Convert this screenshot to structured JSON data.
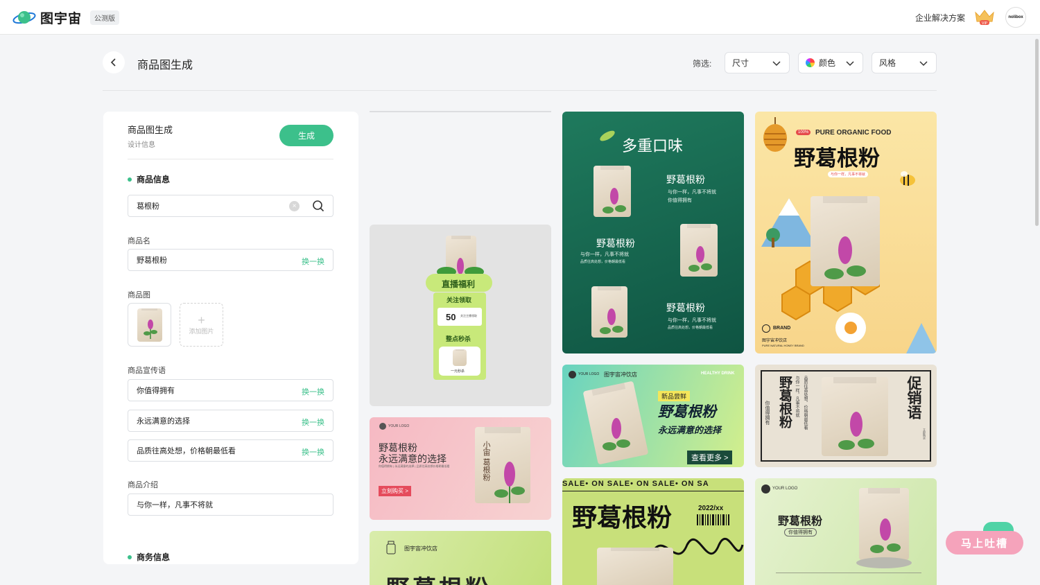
{
  "brand": {
    "name": "图宇宙",
    "beta": "公测版"
  },
  "topbar": {
    "enterprise": "企业解决方案",
    "vip": "VIP",
    "avatar": "nolibox"
  },
  "header": {
    "title": "商品图生成",
    "filter_label": "筛选:",
    "filters": [
      {
        "label": "尺寸"
      },
      {
        "label": "颜色"
      },
      {
        "label": "风格"
      }
    ]
  },
  "panel": {
    "title": "商品图生成",
    "subtitle": "设计信息",
    "generate": "生成",
    "section_product": "商品信息",
    "search_value": "葛根粉",
    "name_label": "商品名",
    "name_value": "野葛根粉",
    "swap": "换一换",
    "image_label": "商品图",
    "add_image": "添加图片",
    "slogan_label": "商品宣传语",
    "slogans": [
      "你值得拥有",
      "永远满意的选择",
      "品质往高处想，价格朝最低看"
    ],
    "intro_label": "商品介绍",
    "intro_value": "与你一样，凡事不将就",
    "section_business": "商务信息"
  },
  "gallery": {
    "live": {
      "title": "直播福利",
      "follow": "关注领取",
      "coupon": "50",
      "coupon_note": "关注主播领取",
      "flash": "整点秒杀",
      "price": "一元秒杀"
    },
    "pink": {
      "logo": "YOUR LOGO",
      "line1": "野葛根粉",
      "line2": "永远满意的选择",
      "small": "你值得拥有 | 永远满意的选择 | 品质往高处想价格朝最低看",
      "cta": "立刻购买 >"
    },
    "green_small": {
      "shop": "图宇宙冲饮店",
      "title": "野葛根粉"
    },
    "flavors": {
      "title": "多重口味",
      "item": "野葛根粉",
      "desc1": "与你一样，凡事不将就",
      "desc2": "你值得拥有",
      "desc3": "品质往高处想，价格朝最低看"
    },
    "banner": {
      "logo": "YOUR LOGO",
      "shop": "图宇宙冲饮店",
      "tag": "HEALTHY DRINK",
      "new": "新品尝鲜",
      "title": "野葛根粉",
      "sub": "永远满意的选择",
      "more": "查看更多 >"
    },
    "sale": {
      "marquee": "SALE• ON  SALE• ON  SALE• ON  SA",
      "title": "野葛根粉",
      "date": "2022/xx"
    },
    "honey": {
      "badge": "100%",
      "top": "PURE ORGANIC FOOD",
      "title": "野葛根粉",
      "tagline": "与你一样，凡事不将就",
      "brand": "BRAND",
      "shop": "图宇宙冲饮店",
      "brand_sub": "PURE NATURAL HONEY BRAND"
    },
    "promo": {
      "left": "野葛根粉",
      "right": "促销语",
      "c1": "你值得拥有",
      "c2": "与你一样，凡事不将就",
      "c3": "品质往高处想，价格朝最低看",
      "stamp": "立即购买"
    },
    "mint": {
      "logo": "YOUR LOGO",
      "title": "野葛根粉",
      "tag": "你值得拥有"
    },
    "bag_label": "小宙 葛根粉"
  },
  "feedback": "马上吐槽",
  "colors": {
    "accent": "#3cc08b",
    "dark_green": "#15664e",
    "honey": "#f9d27a",
    "pink": "#f5a3bb"
  }
}
